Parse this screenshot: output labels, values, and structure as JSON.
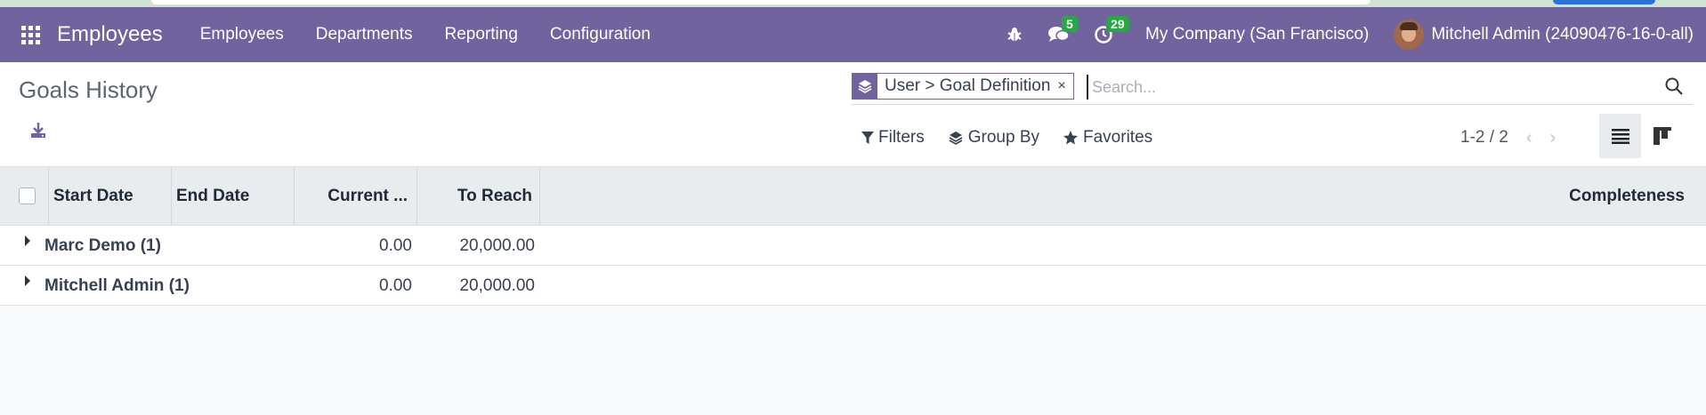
{
  "navbar": {
    "app_name": "Employees",
    "menu": [
      "Employees",
      "Departments",
      "Reporting",
      "Configuration"
    ],
    "messages_count": "5",
    "activities_count": "29",
    "company": "My Company (San Francisco)",
    "user": "Mitchell Admin (24090476-16-0-all)",
    "color": "#71639e"
  },
  "page": {
    "title": "Goals History"
  },
  "search": {
    "facet_label": "User > Goal Definition",
    "facet_remove": "×",
    "placeholder": "Search...",
    "value": ""
  },
  "filters": {
    "filters_label": "Filters",
    "group_by_label": "Group By",
    "favorites_label": "Favorites"
  },
  "pager": {
    "range": "1-2 / 2",
    "prev": "‹",
    "next": "›"
  },
  "table": {
    "columns": [
      "Start Date",
      "End Date",
      "Current ...",
      "To Reach",
      "Completeness"
    ],
    "groups": [
      {
        "name": "Marc Demo (1)",
        "current": "0.00",
        "to_reach": "20,000.00"
      },
      {
        "name": "Mitchell Admin (1)",
        "current": "0.00",
        "to_reach": "20,000.00"
      }
    ]
  },
  "icons": {
    "apps": "apps-grid-icon",
    "debug": "bug-icon",
    "messages": "chat-icon",
    "activities": "clock-icon",
    "download": "download-icon",
    "search": "search-icon",
    "list_view": "list-view-icon",
    "kanban_view": "kanban-view-icon"
  }
}
